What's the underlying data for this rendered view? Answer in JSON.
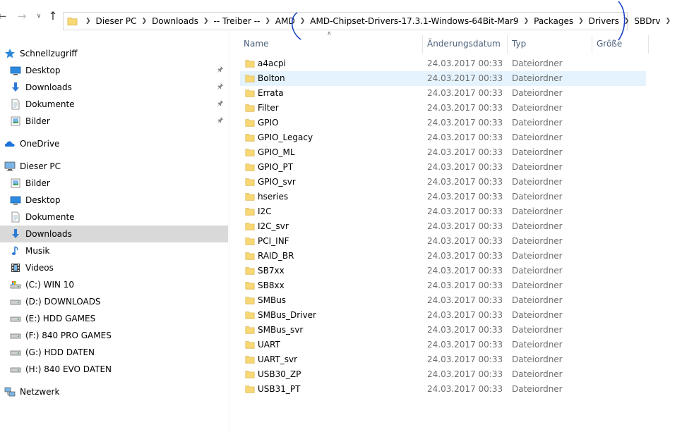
{
  "address_bar": {
    "crumbs": [
      "Dieser PC",
      "Downloads",
      "-- Treiber --",
      "AMD",
      "AMD-Chipset-Drivers-17.3.1-Windows-64Bit-Mar9",
      "Packages",
      "Drivers",
      "SBDrv"
    ]
  },
  "sidebar": {
    "quick_access": {
      "label": "Schnellzugriff",
      "items": [
        {
          "label": "Desktop",
          "icon": "desktop-icon",
          "pinned": true
        },
        {
          "label": "Downloads",
          "icon": "download-arrow-icon",
          "pinned": true
        },
        {
          "label": "Dokumente",
          "icon": "document-icon",
          "pinned": true
        },
        {
          "label": "Bilder",
          "icon": "pictures-icon",
          "pinned": true
        }
      ]
    },
    "onedrive": {
      "label": "OneDrive"
    },
    "this_pc": {
      "label": "Dieser PC",
      "items": [
        {
          "label": "Bilder",
          "icon": "pictures-icon"
        },
        {
          "label": "Desktop",
          "icon": "desktop-icon"
        },
        {
          "label": "Dokumente",
          "icon": "document-icon"
        },
        {
          "label": "Downloads",
          "icon": "download-arrow-icon",
          "selected": true
        },
        {
          "label": "Musik",
          "icon": "music-icon"
        },
        {
          "label": "Videos",
          "icon": "video-icon"
        },
        {
          "label": "(C:) WIN 10",
          "icon": "system-drive-icon"
        },
        {
          "label": "(D:) DOWNLOADS",
          "icon": "drive-icon"
        },
        {
          "label": "(E:) HDD GAMES",
          "icon": "drive-icon"
        },
        {
          "label": "(F:) 840 PRO GAMES",
          "icon": "drive-icon"
        },
        {
          "label": "(G:) HDD DATEN",
          "icon": "drive-icon"
        },
        {
          "label": "(H:) 840 EVO DATEN",
          "icon": "drive-icon"
        }
      ]
    },
    "network": {
      "label": "Netzwerk"
    }
  },
  "columns": {
    "name": "Name",
    "date": "Änderungsdatum",
    "type": "Typ",
    "size": "Größe"
  },
  "files": [
    {
      "name": "a4acpi",
      "date": "24.03.2017 00:33",
      "type": "Dateiordner"
    },
    {
      "name": "Bolton",
      "date": "24.03.2017 00:33",
      "type": "Dateiordner",
      "hover": true
    },
    {
      "name": "Errata",
      "date": "24.03.2017 00:33",
      "type": "Dateiordner"
    },
    {
      "name": "Filter",
      "date": "24.03.2017 00:33",
      "type": "Dateiordner"
    },
    {
      "name": "GPIO",
      "date": "24.03.2017 00:33",
      "type": "Dateiordner"
    },
    {
      "name": "GPIO_Legacy",
      "date": "24.03.2017 00:33",
      "type": "Dateiordner"
    },
    {
      "name": "GPIO_ML",
      "date": "24.03.2017 00:33",
      "type": "Dateiordner"
    },
    {
      "name": "GPIO_PT",
      "date": "24.03.2017 00:33",
      "type": "Dateiordner"
    },
    {
      "name": "GPIO_svr",
      "date": "24.03.2017 00:33",
      "type": "Dateiordner"
    },
    {
      "name": "hseries",
      "date": "24.03.2017 00:33",
      "type": "Dateiordner"
    },
    {
      "name": "I2C",
      "date": "24.03.2017 00:33",
      "type": "Dateiordner"
    },
    {
      "name": "I2C_svr",
      "date": "24.03.2017 00:33",
      "type": "Dateiordner"
    },
    {
      "name": "PCI_INF",
      "date": "24.03.2017 00:33",
      "type": "Dateiordner"
    },
    {
      "name": "RAID_BR",
      "date": "24.03.2017 00:33",
      "type": "Dateiordner"
    },
    {
      "name": "SB7xx",
      "date": "24.03.2017 00:33",
      "type": "Dateiordner"
    },
    {
      "name": "SB8xx",
      "date": "24.03.2017 00:33",
      "type": "Dateiordner"
    },
    {
      "name": "SMBus",
      "date": "24.03.2017 00:33",
      "type": "Dateiordner"
    },
    {
      "name": "SMBus_Driver",
      "date": "24.03.2017 00:33",
      "type": "Dateiordner"
    },
    {
      "name": "SMBus_svr",
      "date": "24.03.2017 00:33",
      "type": "Dateiordner"
    },
    {
      "name": "UART",
      "date": "24.03.2017 00:33",
      "type": "Dateiordner"
    },
    {
      "name": "UART_svr",
      "date": "24.03.2017 00:33",
      "type": "Dateiordner"
    },
    {
      "name": "USB30_ZP",
      "date": "24.03.2017 00:33",
      "type": "Dateiordner"
    },
    {
      "name": "USB31_PT",
      "date": "24.03.2017 00:33",
      "type": "Dateiordner"
    }
  ],
  "colors": {
    "folder": "#f8d775",
    "accent": "#0063b1",
    "selected_bg": "#d9d9d9",
    "hover_bg": "#e5f3ff",
    "header_text": "#4c607a",
    "annotation": "#1a3fc7"
  },
  "icons": {
    "back": "back-arrow-icon",
    "forward": "forward-arrow-icon",
    "recent": "chevron-down-icon",
    "up": "up-arrow-icon",
    "pin": "pin-icon",
    "folder": "folder-icon"
  }
}
